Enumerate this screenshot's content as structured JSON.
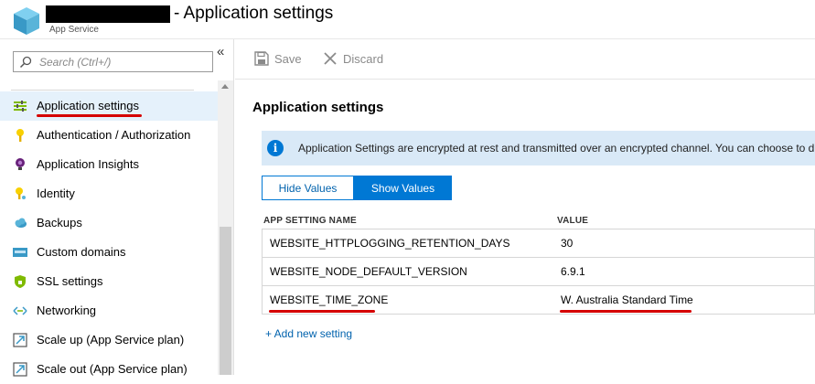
{
  "header": {
    "title": "- Application settings",
    "subtitle": "App Service"
  },
  "sidebar": {
    "search_placeholder": "Search (Ctrl+/)",
    "collapse_glyph": "«",
    "items": [
      {
        "label": "Application settings",
        "icon": "settings-sliders-icon",
        "active": true
      },
      {
        "label": "Authentication / Authorization",
        "icon": "key-icon"
      },
      {
        "label": "Application Insights",
        "icon": "lightbulb-purple-icon"
      },
      {
        "label": "Identity",
        "icon": "key-yellow-icon"
      },
      {
        "label": "Backups",
        "icon": "cloud-icon"
      },
      {
        "label": "Custom domains",
        "icon": "www-icon"
      },
      {
        "label": "SSL settings",
        "icon": "shield-icon"
      },
      {
        "label": "Networking",
        "icon": "network-icon"
      },
      {
        "label": "Scale up (App Service plan)",
        "icon": "scale-up-icon"
      },
      {
        "label": "Scale out (App Service plan)",
        "icon": "scale-out-icon"
      }
    ]
  },
  "toolbar": {
    "save_label": "Save",
    "discard_label": "Discard"
  },
  "main": {
    "section_title": "Application settings",
    "info_text": "Application Settings are encrypted at rest and transmitted over an encrypted channel. You can choose to dis",
    "hide_values_label": "Hide Values",
    "show_values_label": "Show Values",
    "col_name": "APP SETTING NAME",
    "col_value": "VALUE",
    "rows": [
      {
        "name": "WEBSITE_HTTPLOGGING_RETENTION_DAYS",
        "value": "30"
      },
      {
        "name": "WEBSITE_NODE_DEFAULT_VERSION",
        "value": "6.9.1"
      },
      {
        "name": "WEBSITE_TIME_ZONE",
        "value": "W. Australia Standard Time"
      }
    ],
    "add_label": "+ Add new setting"
  },
  "colors": {
    "accent": "#0078d4",
    "highlight": "#d50000",
    "info_bg": "#d9e9f7"
  }
}
